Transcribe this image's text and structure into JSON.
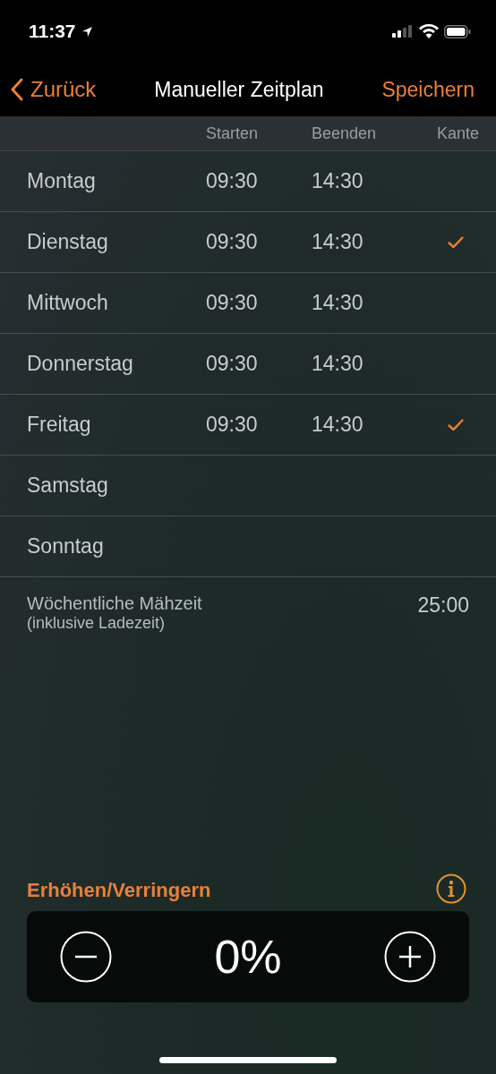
{
  "status_bar": {
    "time": "11:37"
  },
  "nav": {
    "back": "Zurück",
    "title": "Manueller Zeitplan",
    "save": "Speichern"
  },
  "table": {
    "columns": [
      "Starten",
      "Beenden",
      "Kante"
    ],
    "rows": [
      {
        "day": "Montag",
        "start": "09:30",
        "end": "14:30",
        "edge": false
      },
      {
        "day": "Dienstag",
        "start": "09:30",
        "end": "14:30",
        "edge": true
      },
      {
        "day": "Mittwoch",
        "start": "09:30",
        "end": "14:30",
        "edge": false
      },
      {
        "day": "Donnerstag",
        "start": "09:30",
        "end": "14:30",
        "edge": false
      },
      {
        "day": "Freitag",
        "start": "09:30",
        "end": "14:30",
        "edge": true
      },
      {
        "day": "Samstag",
        "edge": false
      },
      {
        "day": "Sonntag",
        "edge": false
      }
    ]
  },
  "summary": {
    "label": "Wöchentliche Mähzeit",
    "note": "(inklusive Ladezeit)",
    "value": "25:00"
  },
  "adjust": {
    "title": "Erhöhen/Verringern",
    "value": "0%"
  }
}
